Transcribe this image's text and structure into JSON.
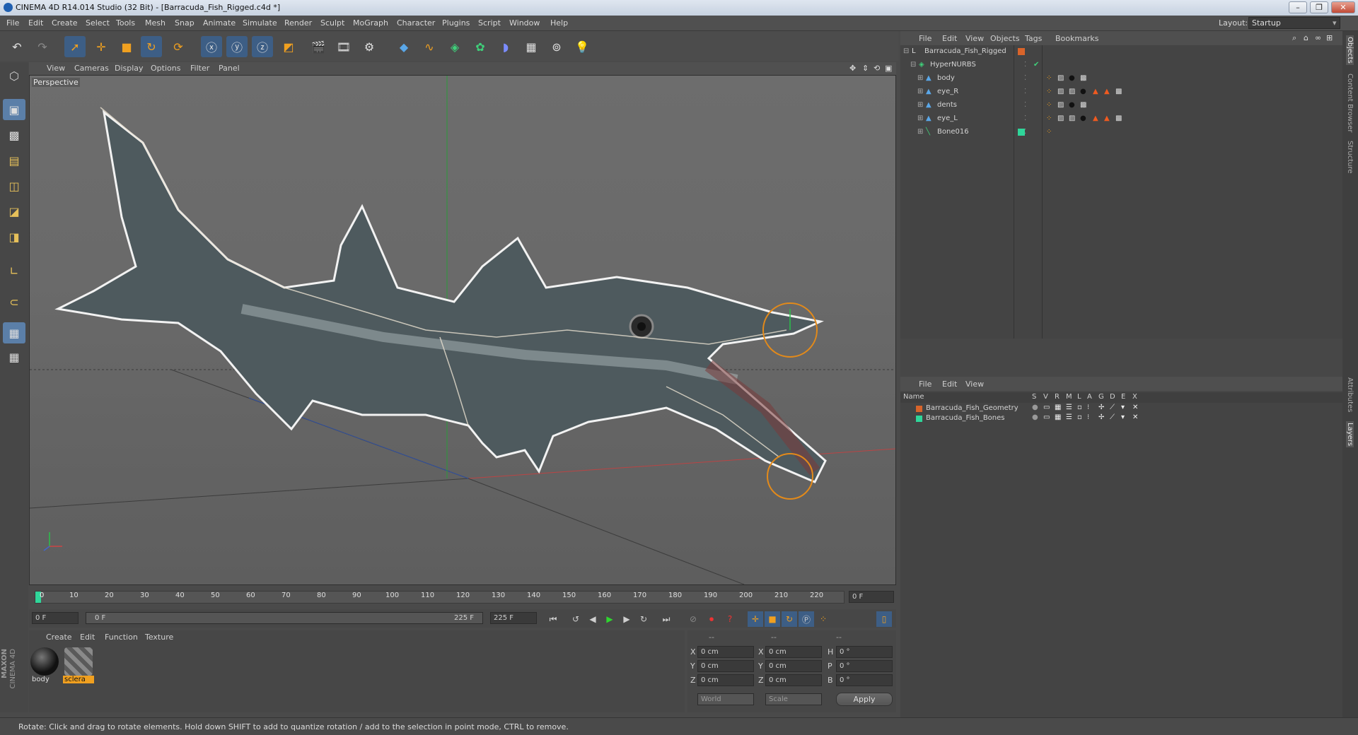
{
  "app": {
    "title": "CINEMA 4D R14.014 Studio (32 Bit) - [Barracuda_Fish_Rigged.c4d *]",
    "layout_label": "Layout:",
    "layout_value": "Startup"
  },
  "menu": [
    "File",
    "Edit",
    "Create",
    "Select",
    "Tools",
    "Mesh",
    "Snap",
    "Animate",
    "Simulate",
    "Render",
    "Sculpt",
    "MoGraph",
    "Character",
    "Plugins",
    "Script",
    "Window",
    "Help"
  ],
  "viewport": {
    "menu": [
      "View",
      "Cameras",
      "Display",
      "Options",
      "Filter",
      "Panel"
    ],
    "label": "Perspective"
  },
  "timeline": {
    "ticks": [
      "0",
      "10",
      "20",
      "30",
      "40",
      "50",
      "60",
      "70",
      "80",
      "90",
      "100",
      "110",
      "120",
      "130",
      "140",
      "150",
      "160",
      "170",
      "180",
      "190",
      "200",
      "210",
      "220"
    ],
    "current_frame": "0 F",
    "start_field": "0 F",
    "range_start": "0 F",
    "range_end": "225 F",
    "end_field": "225 F"
  },
  "materials": {
    "menu": [
      "Create",
      "Edit",
      "Function",
      "Texture"
    ],
    "items": [
      {
        "name": "body"
      },
      {
        "name": "sclera"
      }
    ],
    "brand_top": "MAXON",
    "brand_bottom": "CINEMA 4D"
  },
  "coords": {
    "header_a": "--",
    "header_b": "--",
    "header_c": "--",
    "rows": [
      {
        "a_label": "X",
        "a_val": "0 cm",
        "b_label": "X",
        "b_val": "0 cm",
        "c_label": "H",
        "c_val": "0 °"
      },
      {
        "a_label": "Y",
        "a_val": "0 cm",
        "b_label": "Y",
        "b_val": "0 cm",
        "c_label": "P",
        "c_val": "0 °"
      },
      {
        "a_label": "Z",
        "a_val": "0 cm",
        "b_label": "Z",
        "b_val": "0 cm",
        "c_label": "B",
        "c_val": "0 °"
      }
    ],
    "world": "World",
    "scale": "Scale",
    "apply": "Apply"
  },
  "object_manager": {
    "menu": [
      "File",
      "Edit",
      "View",
      "Objects",
      "Tags",
      "Bookmarks"
    ],
    "objects": [
      {
        "name": "Barracuda_Fish_Rigged",
        "indent": 0,
        "swatch": "#d9642a"
      },
      {
        "name": "HyperNURBS",
        "indent": 1,
        "swatch": ""
      },
      {
        "name": "body",
        "indent": 2,
        "swatch": ""
      },
      {
        "name": "eye_R",
        "indent": 2,
        "swatch": ""
      },
      {
        "name": "dents",
        "indent": 2,
        "swatch": ""
      },
      {
        "name": "eye_L",
        "indent": 2,
        "swatch": ""
      },
      {
        "name": "Bone016",
        "indent": 2,
        "swatch": "#2fd69a"
      }
    ]
  },
  "layer_manager": {
    "menu": [
      "File",
      "Edit",
      "View"
    ],
    "columns": [
      "Name",
      "S",
      "V",
      "R",
      "M",
      "L",
      "A",
      "G",
      "D",
      "E",
      "X"
    ],
    "layers": [
      {
        "name": "Barracuda_Fish_Geometry",
        "color": "#d9642a"
      },
      {
        "name": "Barracuda_Fish_Bones",
        "color": "#2fd69a"
      }
    ]
  },
  "side_tabs": [
    "Objects",
    "Content Browser",
    "Structure",
    "Attributes",
    "Layers"
  ],
  "status": "Rotate: Click and drag to rotate elements. Hold down SHIFT to add to quantize rotation / add to the selection in point mode, CTRL to remove.",
  "colors": {
    "accent": "#3d5e85",
    "orange": "#f0a020",
    "geometry_layer": "#d9642a",
    "bones_layer": "#2fd69a"
  }
}
